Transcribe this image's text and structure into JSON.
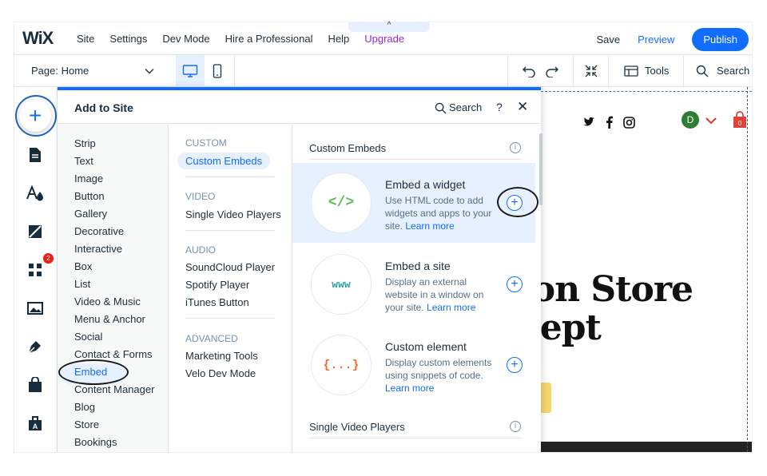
{
  "topbar": {
    "logo": "WiX",
    "menu": [
      "Site",
      "Settings",
      "Dev Mode",
      "Hire a Professional",
      "Help",
      "Upgrade"
    ],
    "pulltab": "^",
    "save": "Save",
    "preview": "Preview",
    "publish": "Publish"
  },
  "toolbar": {
    "page_label": "Page:",
    "page_value": "Home",
    "tools": "Tools",
    "search": "Search"
  },
  "rail": {
    "add_icon": "+",
    "badge_count": "2"
  },
  "panel": {
    "title": "Add to Site",
    "search": "Search",
    "help": "?",
    "close": "✕",
    "categories": [
      "Strip",
      "Text",
      "Image",
      "Button",
      "Gallery",
      "Decorative",
      "Interactive",
      "Box",
      "List",
      "Video & Music",
      "Menu & Anchor",
      "Social",
      "Contact & Forms",
      "Embed",
      "Content Manager",
      "Blog",
      "Store",
      "Bookings"
    ],
    "selected_category": "Embed",
    "sub": {
      "custom_header": "CUSTOM",
      "custom_items": [
        "Custom Embeds"
      ],
      "video_header": "VIDEO",
      "video_items": [
        "Single Video Players"
      ],
      "audio_header": "AUDIO",
      "audio_items": [
        "SoundCloud Player",
        "Spotify Player",
        "iTunes Button"
      ],
      "advanced_header": "ADVANCED",
      "advanced_items": [
        "Marketing Tools",
        "Velo Dev Mode"
      ]
    },
    "content": {
      "section1": "Custom Embeds",
      "section2": "Single Video Players",
      "cards": [
        {
          "thumb": "</>",
          "title": "Embed a widget",
          "desc": "Use HTML code to add widgets and apps to your site.",
          "link": "Learn more",
          "thumb_color": "#60bc57"
        },
        {
          "thumb": "www",
          "title": "Embed a site",
          "desc": "Display an external website in a window on your site.",
          "link": "Learn more",
          "thumb_color": "#20a0a8"
        },
        {
          "thumb": "{...}",
          "title": "Custom element",
          "desc": "Display custom elements using snippets of code.",
          "link": "Learn more",
          "thumb_color": "#f06a2a"
        }
      ]
    }
  },
  "canvas": {
    "avatar_letter": "D",
    "cart_count": "0",
    "hero_line1": "ion Store",
    "hero_line2": "cept"
  },
  "colors": {
    "accent": "#116dff",
    "upgrade": "#9a27d5",
    "badge": "#e62214"
  }
}
